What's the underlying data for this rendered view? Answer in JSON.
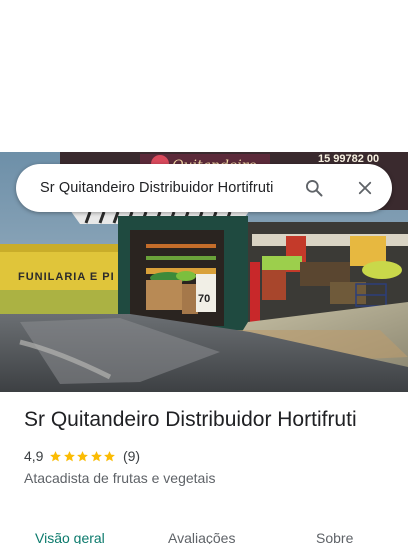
{
  "search": {
    "value": "Sr Quitandeiro Distribuidor Hortifruti",
    "search_icon": "search-icon",
    "close_icon": "close-icon"
  },
  "place": {
    "name": "Sr Quitandeiro Distribuidor Hortifruti",
    "rating": "4,9",
    "rating_value": 4.9,
    "stars_filled": 5,
    "review_count": "(9)",
    "category": "Atacadista de frutas e vegetais"
  },
  "photo": {
    "wall_sign": "FUNILARIA E PI",
    "shop_sign": "Quitandeiro",
    "phone_fragment": "15 99782 00",
    "price_sign": "70"
  },
  "tabs": [
    {
      "label": "Visão geral",
      "active": true
    },
    {
      "label": "Avaliações",
      "active": false
    },
    {
      "label": "Sobre",
      "active": false
    }
  ],
  "colors": {
    "accent": "#0b7a6c",
    "star": "#fbbc04",
    "text_primary": "#202124",
    "text_secondary": "#5f6368"
  }
}
